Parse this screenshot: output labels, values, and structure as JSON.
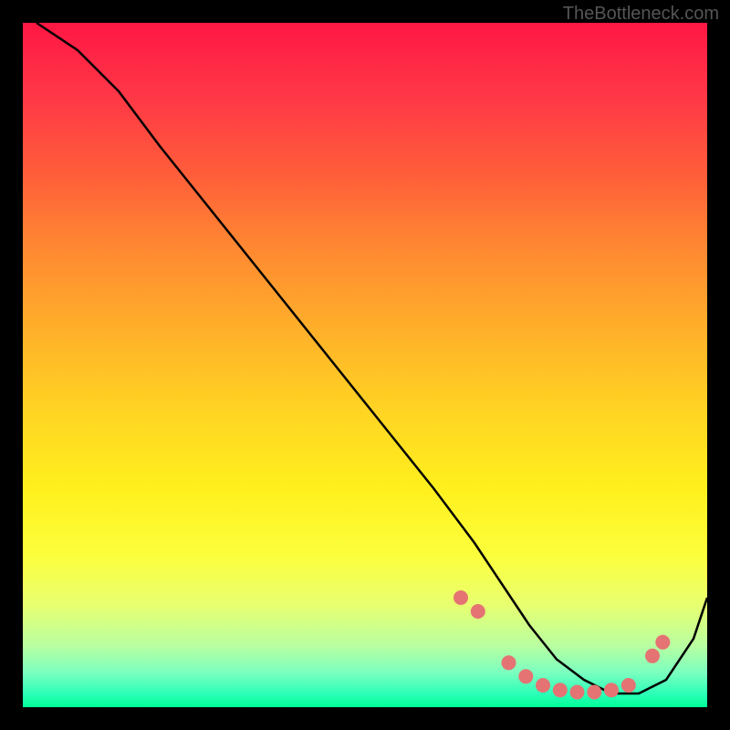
{
  "watermark": "TheBottleneck.com",
  "chart_data": {
    "type": "line",
    "title": "",
    "xlabel": "",
    "ylabel": "",
    "xlim": [
      0,
      100
    ],
    "ylim": [
      0,
      100
    ],
    "series": [
      {
        "name": "curve",
        "x": [
          2,
          8,
          14,
          20,
          28,
          36,
          44,
          52,
          60,
          66,
          70,
          74,
          78,
          82,
          86,
          90,
          94,
          98,
          100
        ],
        "y": [
          100,
          96,
          90,
          82,
          72,
          62,
          52,
          42,
          32,
          24,
          18,
          12,
          7,
          4,
          2,
          2,
          4,
          10,
          16
        ]
      }
    ],
    "markers": {
      "name": "dots",
      "color": "#e57373",
      "x": [
        64,
        66.5,
        71,
        73.5,
        76,
        78.5,
        81,
        83.5,
        86,
        88.5,
        92,
        93.5
      ],
      "y": [
        16,
        14,
        6.5,
        4.5,
        3.2,
        2.5,
        2.2,
        2.2,
        2.5,
        3.2,
        7.5,
        9.5
      ]
    }
  }
}
